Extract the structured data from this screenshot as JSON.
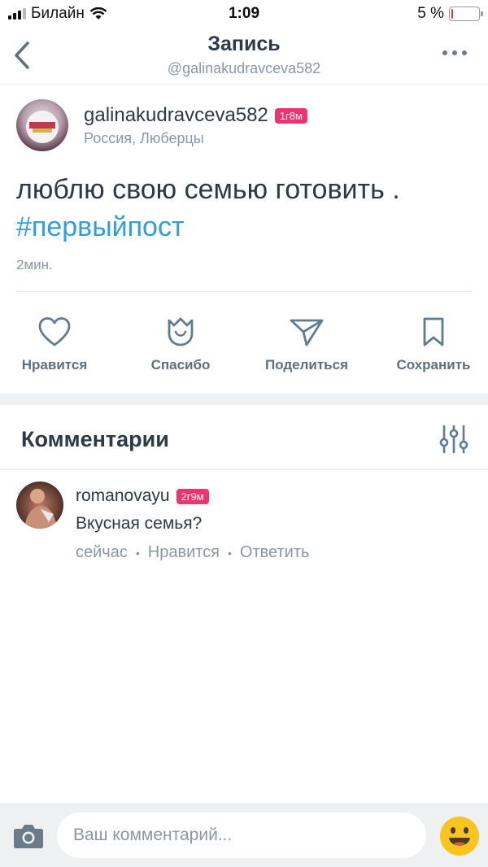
{
  "status_bar": {
    "carrier": "Билайн",
    "time": "1:09",
    "battery_percent": "5 %",
    "battery_level": 0.05
  },
  "nav": {
    "title": "Запись",
    "subtitle": "@galinakudravceva582"
  },
  "post": {
    "username": "galinakudravceva582",
    "badge": "1г8м",
    "location": "Россия, Люберцы",
    "text": "люблю свою семью готовить .",
    "hashtag": "#первыйпост",
    "time": "2мин."
  },
  "actions": [
    {
      "label": "Нравится",
      "icon": "heart-icon"
    },
    {
      "label": "Спасибо",
      "icon": "tulip-icon"
    },
    {
      "label": "Поделиться",
      "icon": "send-icon"
    },
    {
      "label": "Сохранить",
      "icon": "bookmark-icon"
    }
  ],
  "comments": {
    "title": "Комментарии",
    "items": [
      {
        "username": "romanovayu",
        "badge": "2г9м",
        "text": "Вкусная семья?",
        "time": "сейчас",
        "like": "Нравится",
        "reply": "Ответить"
      }
    ]
  },
  "composer": {
    "placeholder": "Ваш комментарий..."
  },
  "colors": {
    "accent": "#2f9fe0",
    "badge": "#f0336e",
    "muted": "#8a98a4",
    "text": "#2b3a44"
  }
}
